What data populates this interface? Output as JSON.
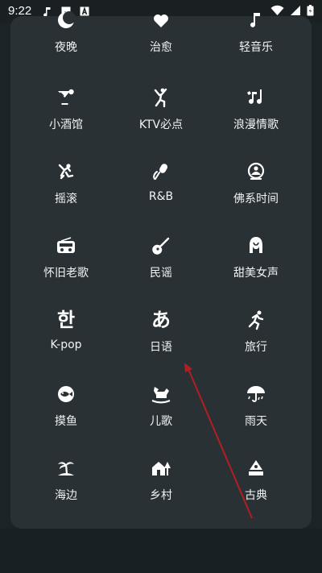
{
  "status": {
    "time": "9:22",
    "left_icons": [
      "music-note-icon",
      "image-icon",
      "a-box-icon"
    ],
    "right_icons": [
      "wifi-icon",
      "signal-icon",
      "battery-icon"
    ]
  },
  "categories": [
    {
      "label": "夜晚",
      "icon": "moon-icon"
    },
    {
      "label": "治愈",
      "icon": "heal-icon"
    },
    {
      "label": "轻音乐",
      "icon": "light-music-icon"
    },
    {
      "label": "小酒馆",
      "icon": "cocktail-icon"
    },
    {
      "label": "KTV必点",
      "icon": "dancer-icon"
    },
    {
      "label": "浪漫情歌",
      "icon": "music-notes-icon"
    },
    {
      "label": "摇滚",
      "icon": "rock-icon"
    },
    {
      "label": "R&B",
      "icon": "microphone-icon"
    },
    {
      "label": "佛系时间",
      "icon": "zen-icon"
    },
    {
      "label": "怀旧老歌",
      "icon": "radio-icon"
    },
    {
      "label": "民谣",
      "icon": "guitar-icon"
    },
    {
      "label": "甜美女声",
      "icon": "woman-icon"
    },
    {
      "label": "K-pop",
      "icon": "hangul-icon",
      "glyph": "한"
    },
    {
      "label": "日语",
      "icon": "hiragana-icon",
      "glyph": "あ"
    },
    {
      "label": "旅行",
      "icon": "running-icon"
    },
    {
      "label": "摸鱼",
      "icon": "fish-icon"
    },
    {
      "label": "儿歌",
      "icon": "rocking-horse-icon"
    },
    {
      "label": "雨天",
      "icon": "umbrella-rain-icon"
    },
    {
      "label": "海边",
      "icon": "palm-island-icon"
    },
    {
      "label": "乡村",
      "icon": "house-tree-icon"
    },
    {
      "label": "古典",
      "icon": "gramophone-icon"
    }
  ],
  "colors": {
    "background": "#1c2326",
    "card": "#2a3134",
    "arrow": "#b01f24"
  }
}
